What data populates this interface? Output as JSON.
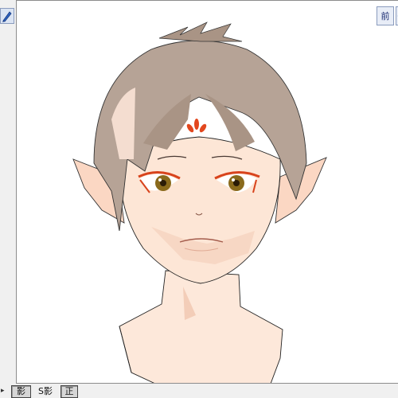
{
  "viewport": {
    "front_view_label": "前",
    "move_icon": "four-way-arrow-icon",
    "corner_icon": "pen-tool-icon"
  },
  "bottom_bar": {
    "arrow": "▸",
    "shadow_label": "影",
    "self_shadow_label": "S影",
    "edge_label": "正"
  },
  "colors": {
    "skin": "#fbe3d3",
    "hair": "#b29f92",
    "eye_liner": "#d8431c",
    "iris": "#8a6a1c",
    "forehead_mark": "#e2471e",
    "panel_border": "#8a9bbd",
    "panel_fill": "#e8edf7"
  }
}
